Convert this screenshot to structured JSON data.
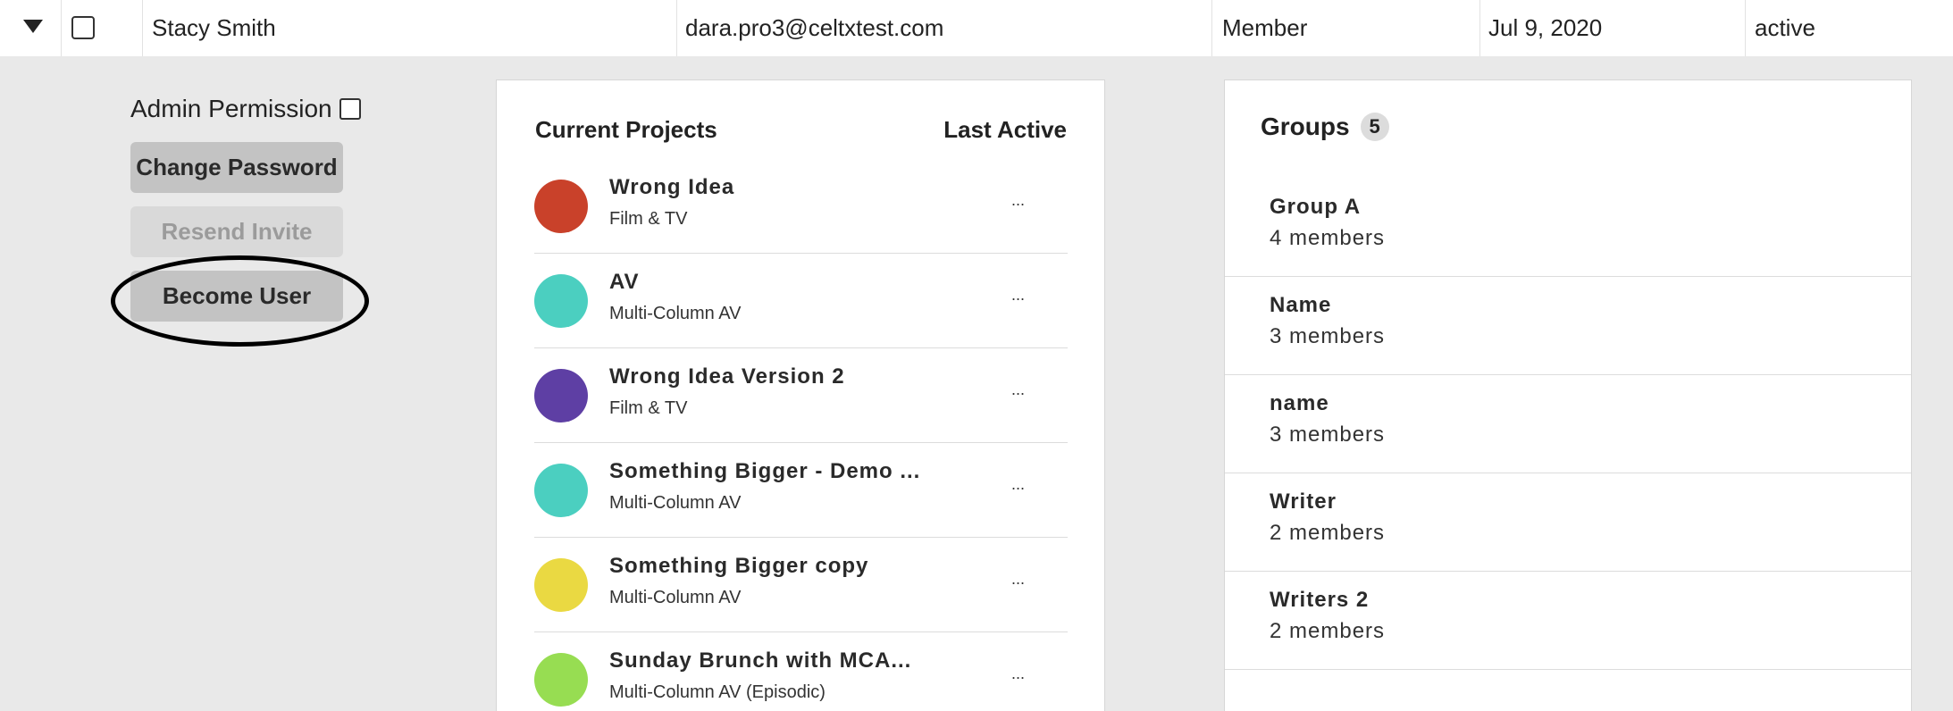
{
  "user_row": {
    "name": "Stacy Smith",
    "email": "dara.pro3@celtxtest.com",
    "role": "Member",
    "date": "Jul 9, 2020",
    "status": "active"
  },
  "left_panel": {
    "admin_permission_label": "Admin Permission",
    "change_password_label": "Change Password",
    "resend_invite_label": "Resend Invite",
    "become_user_label": "Become User"
  },
  "projects": {
    "title": "Current Projects",
    "last_active_header": "Last Active",
    "items": [
      {
        "name": "Wrong Idea",
        "type": "Film & TV",
        "color": "#c9412a",
        "last_active": "..."
      },
      {
        "name": "AV",
        "type": "Multi-Column AV",
        "color": "#4bcfc0",
        "last_active": "..."
      },
      {
        "name": "Wrong Idea Version 2",
        "type": "Film & TV",
        "color": "#5e3fa4",
        "last_active": "..."
      },
      {
        "name": "Something Bigger - Demo ...",
        "type": "Multi-Column AV",
        "color": "#4bcfc0",
        "last_active": "..."
      },
      {
        "name": "Something Bigger copy",
        "type": "Multi-Column AV",
        "color": "#ead942",
        "last_active": "..."
      },
      {
        "name": "Sunday Brunch with MCA...",
        "type": "Multi-Column AV (Episodic)",
        "color": "#97dd52",
        "last_active": "..."
      }
    ]
  },
  "groups": {
    "title": "Groups",
    "count": "5",
    "items": [
      {
        "name": "Group A",
        "members": "4 members"
      },
      {
        "name": "Name",
        "members": "3 members"
      },
      {
        "name": "name",
        "members": "3 members"
      },
      {
        "name": "Writer",
        "members": "2 members"
      },
      {
        "name": "Writers 2",
        "members": "2 members"
      }
    ]
  }
}
